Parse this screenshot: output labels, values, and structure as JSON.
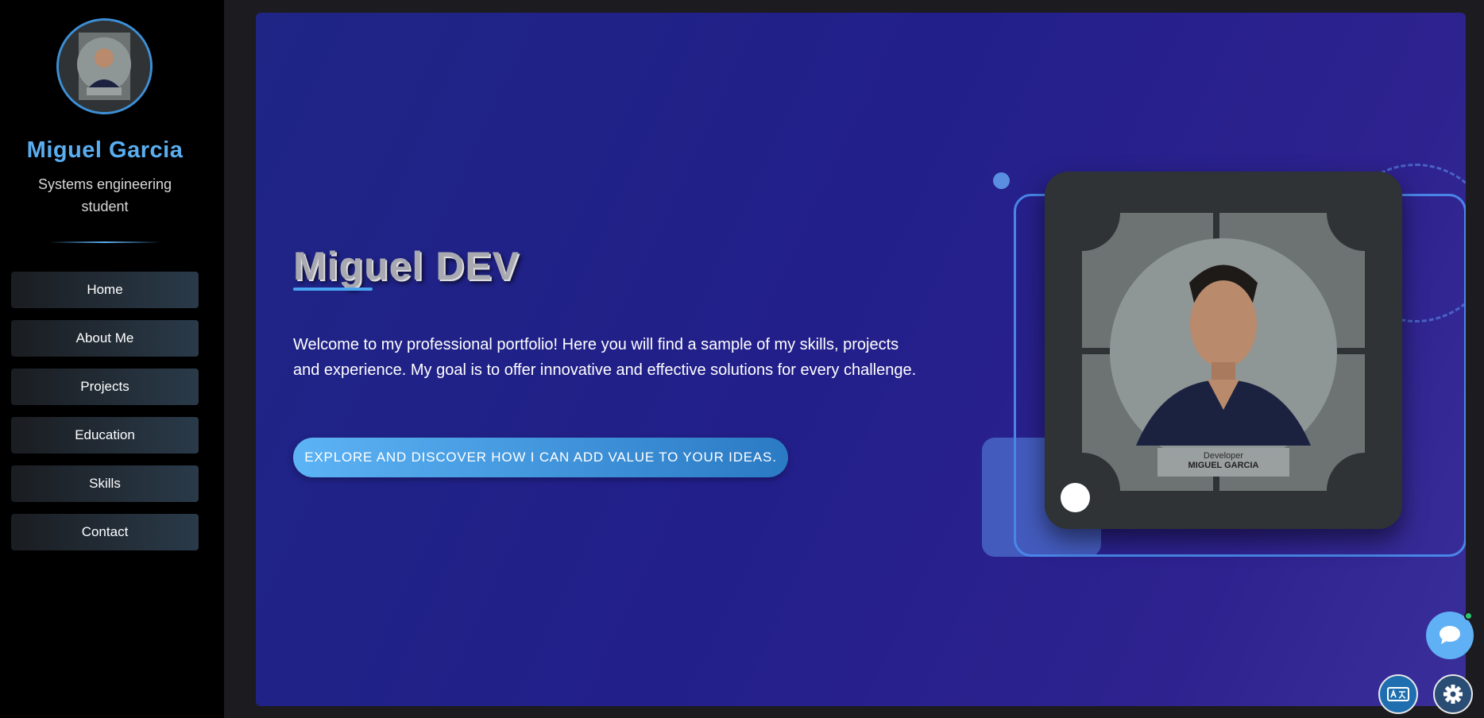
{
  "sidebar": {
    "name": "Miguel Garcia",
    "role": "Systems engineering student",
    "nav": [
      {
        "label": "Home"
      },
      {
        "label": "About Me"
      },
      {
        "label": "Projects"
      },
      {
        "label": "Education"
      },
      {
        "label": "Skills"
      },
      {
        "label": "Contact"
      }
    ]
  },
  "hero": {
    "title": "Miguel DEV",
    "intro": "Welcome to my professional portfolio! Here you will find a sample of my skills, projects and experience. My goal is to offer innovative and effective solutions for every challenge.",
    "cta_label": "EXPLORE AND DISCOVER HOW I CAN ADD VALUE TO YOUR IDEAS.",
    "badge": {
      "role": "Developer",
      "name": "MIGUEL GARCIA"
    }
  },
  "icons": {
    "chat": "chat-bubble-icon",
    "translate": "translate-icon",
    "settings": "gear-icon"
  },
  "colors": {
    "accent": "#5aaef0",
    "hero_bg": "#221f8a",
    "online": "#2ec46e"
  }
}
